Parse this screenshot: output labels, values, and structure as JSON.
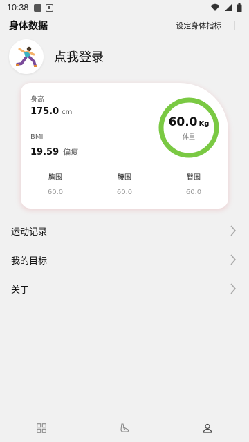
{
  "status_bar": {
    "time": "10:38"
  },
  "header": {
    "title": "身体数据",
    "set_link": "设定身体指标",
    "plus": "+"
  },
  "profile": {
    "login_label": "点我登录"
  },
  "card": {
    "height": {
      "label": "身高",
      "value": "175.0",
      "unit": "cm"
    },
    "bmi": {
      "label": "BMI",
      "value": "19.59",
      "status": "偏瘦"
    },
    "weight": {
      "value": "60.0",
      "unit": "Kg",
      "label": "体重"
    },
    "circumferences": [
      {
        "label": "胸围",
        "value": "60.0"
      },
      {
        "label": "腰围",
        "value": "60.0"
      },
      {
        "label": "臀围",
        "value": "60.0"
      }
    ],
    "ring_color": "#7ac943"
  },
  "menu": [
    {
      "label": "运动记录"
    },
    {
      "label": "我的目标"
    },
    {
      "label": "关于"
    }
  ],
  "bottom_nav": {
    "items": [
      {
        "icon": "grid-icon"
      },
      {
        "icon": "shoe-icon"
      },
      {
        "icon": "person-icon"
      }
    ]
  }
}
